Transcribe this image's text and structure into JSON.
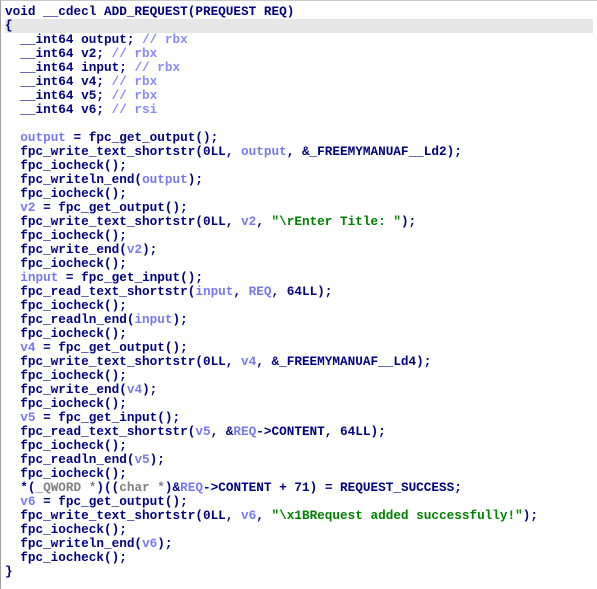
{
  "colors": {
    "code": "#000080",
    "variable": "#7878f0",
    "comment": "#8a8aff",
    "string": "#008000",
    "type_cast": "#808080",
    "highlight_line": "#e6e6e6"
  },
  "highlighted_line": 1,
  "lines": [
    [
      [
        "k",
        "void __cdecl ADD_REQUEST(PREQUEST REQ)"
      ]
    ],
    [
      [
        "k",
        "{"
      ]
    ],
    [
      [
        "k",
        "  __int64 output; "
      ],
      [
        "c",
        "// rbx"
      ]
    ],
    [
      [
        "k",
        "  __int64 v2; "
      ],
      [
        "c",
        "// rbx"
      ]
    ],
    [
      [
        "k",
        "  __int64 input; "
      ],
      [
        "c",
        "// rbx"
      ]
    ],
    [
      [
        "k",
        "  __int64 v4; "
      ],
      [
        "c",
        "// rbx"
      ]
    ],
    [
      [
        "k",
        "  __int64 v5; "
      ],
      [
        "c",
        "// rbx"
      ]
    ],
    [
      [
        "k",
        "  __int64 v6; "
      ],
      [
        "c",
        "// rsi"
      ]
    ],
    [],
    [
      [
        "k",
        "  "
      ],
      [
        "v",
        "output"
      ],
      [
        "k",
        " = fpc_get_output();"
      ]
    ],
    [
      [
        "k",
        "  fpc_write_text_shortstr(0LL, "
      ],
      [
        "v",
        "output"
      ],
      [
        "k",
        ", &_FREEMYMANUAF__Ld2);"
      ]
    ],
    [
      [
        "k",
        "  fpc_iocheck();"
      ]
    ],
    [
      [
        "k",
        "  fpc_writeln_end("
      ],
      [
        "v",
        "output"
      ],
      [
        "k",
        ");"
      ]
    ],
    [
      [
        "k",
        "  fpc_iocheck();"
      ]
    ],
    [
      [
        "k",
        "  "
      ],
      [
        "v",
        "v2"
      ],
      [
        "k",
        " = fpc_get_output();"
      ]
    ],
    [
      [
        "k",
        "  fpc_write_text_shortstr(0LL, "
      ],
      [
        "v",
        "v2"
      ],
      [
        "k",
        ", "
      ],
      [
        "s",
        "\"\\rEnter Title: \""
      ],
      [
        "k",
        ");"
      ]
    ],
    [
      [
        "k",
        "  fpc_iocheck();"
      ]
    ],
    [
      [
        "k",
        "  fpc_write_end("
      ],
      [
        "v",
        "v2"
      ],
      [
        "k",
        ");"
      ]
    ],
    [
      [
        "k",
        "  fpc_iocheck();"
      ]
    ],
    [
      [
        "k",
        "  "
      ],
      [
        "v",
        "input"
      ],
      [
        "k",
        " = fpc_get_input();"
      ]
    ],
    [
      [
        "k",
        "  fpc_read_text_shortstr("
      ],
      [
        "v",
        "input"
      ],
      [
        "k",
        ", "
      ],
      [
        "v",
        "REQ"
      ],
      [
        "k",
        ", 64LL);"
      ]
    ],
    [
      [
        "k",
        "  fpc_iocheck();"
      ]
    ],
    [
      [
        "k",
        "  fpc_readln_end("
      ],
      [
        "v",
        "input"
      ],
      [
        "k",
        ");"
      ]
    ],
    [
      [
        "k",
        "  fpc_iocheck();"
      ]
    ],
    [
      [
        "k",
        "  "
      ],
      [
        "v",
        "v4"
      ],
      [
        "k",
        " = fpc_get_output();"
      ]
    ],
    [
      [
        "k",
        "  fpc_write_text_shortstr(0LL, "
      ],
      [
        "v",
        "v4"
      ],
      [
        "k",
        ", &_FREEMYMANUAF__Ld4);"
      ]
    ],
    [
      [
        "k",
        "  fpc_iocheck();"
      ]
    ],
    [
      [
        "k",
        "  fpc_write_end("
      ],
      [
        "v",
        "v4"
      ],
      [
        "k",
        ");"
      ]
    ],
    [
      [
        "k",
        "  fpc_iocheck();"
      ]
    ],
    [
      [
        "k",
        "  "
      ],
      [
        "v",
        "v5"
      ],
      [
        "k",
        " = fpc_get_input();"
      ]
    ],
    [
      [
        "k",
        "  fpc_read_text_shortstr("
      ],
      [
        "v",
        "v5"
      ],
      [
        "k",
        ", &"
      ],
      [
        "v",
        "REQ"
      ],
      [
        "k",
        "->CONTENT, 64LL);"
      ]
    ],
    [
      [
        "k",
        "  fpc_iocheck();"
      ]
    ],
    [
      [
        "k",
        "  fpc_readln_end("
      ],
      [
        "v",
        "v5"
      ],
      [
        "k",
        ");"
      ]
    ],
    [
      [
        "k",
        "  fpc_iocheck();"
      ]
    ],
    [
      [
        "k",
        "  *("
      ],
      [
        "g",
        "_QWORD *"
      ],
      [
        "k",
        ")(("
      ],
      [
        "g",
        "char *"
      ],
      [
        "k",
        ")&"
      ],
      [
        "v",
        "REQ"
      ],
      [
        "k",
        "->CONTENT + 71) = REQUEST_SUCCESS;"
      ]
    ],
    [
      [
        "k",
        "  "
      ],
      [
        "v",
        "v6"
      ],
      [
        "k",
        " = fpc_get_output();"
      ]
    ],
    [
      [
        "k",
        "  fpc_write_text_shortstr(0LL, "
      ],
      [
        "v",
        "v6"
      ],
      [
        "k",
        ", "
      ],
      [
        "s",
        "\"\\x1BRequest added successfully!\""
      ],
      [
        "k",
        ");"
      ]
    ],
    [
      [
        "k",
        "  fpc_iocheck();"
      ]
    ],
    [
      [
        "k",
        "  fpc_writeln_end("
      ],
      [
        "v",
        "v6"
      ],
      [
        "k",
        ");"
      ]
    ],
    [
      [
        "k",
        "  fpc_iocheck();"
      ]
    ],
    [
      [
        "k",
        "}"
      ]
    ]
  ]
}
